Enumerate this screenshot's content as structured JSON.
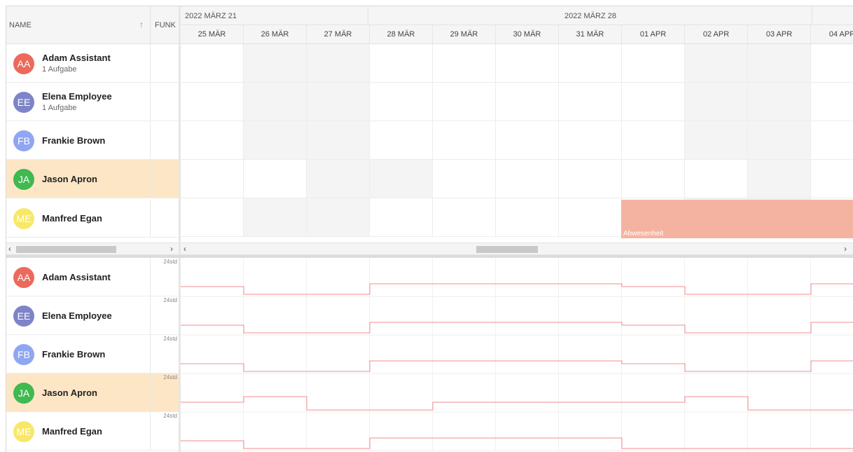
{
  "header": {
    "name_col": "NAME",
    "funk_col": "FUNK",
    "sort_icon": "arrow-up"
  },
  "weeks": [
    {
      "label": "2022 MÄRZ 21"
    },
    {
      "label": "2022 MÄRZ 28"
    }
  ],
  "days": [
    "25 MÄR",
    "26 MÄR",
    "27 MÄR",
    "28 MÄR",
    "29 MÄR",
    "30 MÄR",
    "31 MÄR",
    "01 APR",
    "02 APR",
    "03 APR",
    "04 APR"
  ],
  "resources": [
    {
      "initials": "AA",
      "name": "Adam Assistant",
      "sub": "1 Aufgabe",
      "color": "#ec6a5b"
    },
    {
      "initials": "EE",
      "name": "Elena Employee",
      "sub": "1 Aufgabe",
      "color": "#7e84c8"
    },
    {
      "initials": "FB",
      "name": "Frankie Brown",
      "sub": "",
      "color": "#8fa6f2"
    },
    {
      "initials": "JA",
      "name": "Jason Apron",
      "sub": "",
      "color": "#3fb950"
    },
    {
      "initials": "ME",
      "name": "Manfred Egan",
      "sub": "",
      "color": "#f8e86a"
    }
  ],
  "selected_resource": "Jason Apron",
  "event": {
    "label": "Abwesenheit",
    "resource": "Manfred Egan",
    "start_day": "01 APR",
    "color": "#f4b3a0"
  },
  "histogram": {
    "max_label": "24std",
    "line_color": "#f08c8c"
  }
}
